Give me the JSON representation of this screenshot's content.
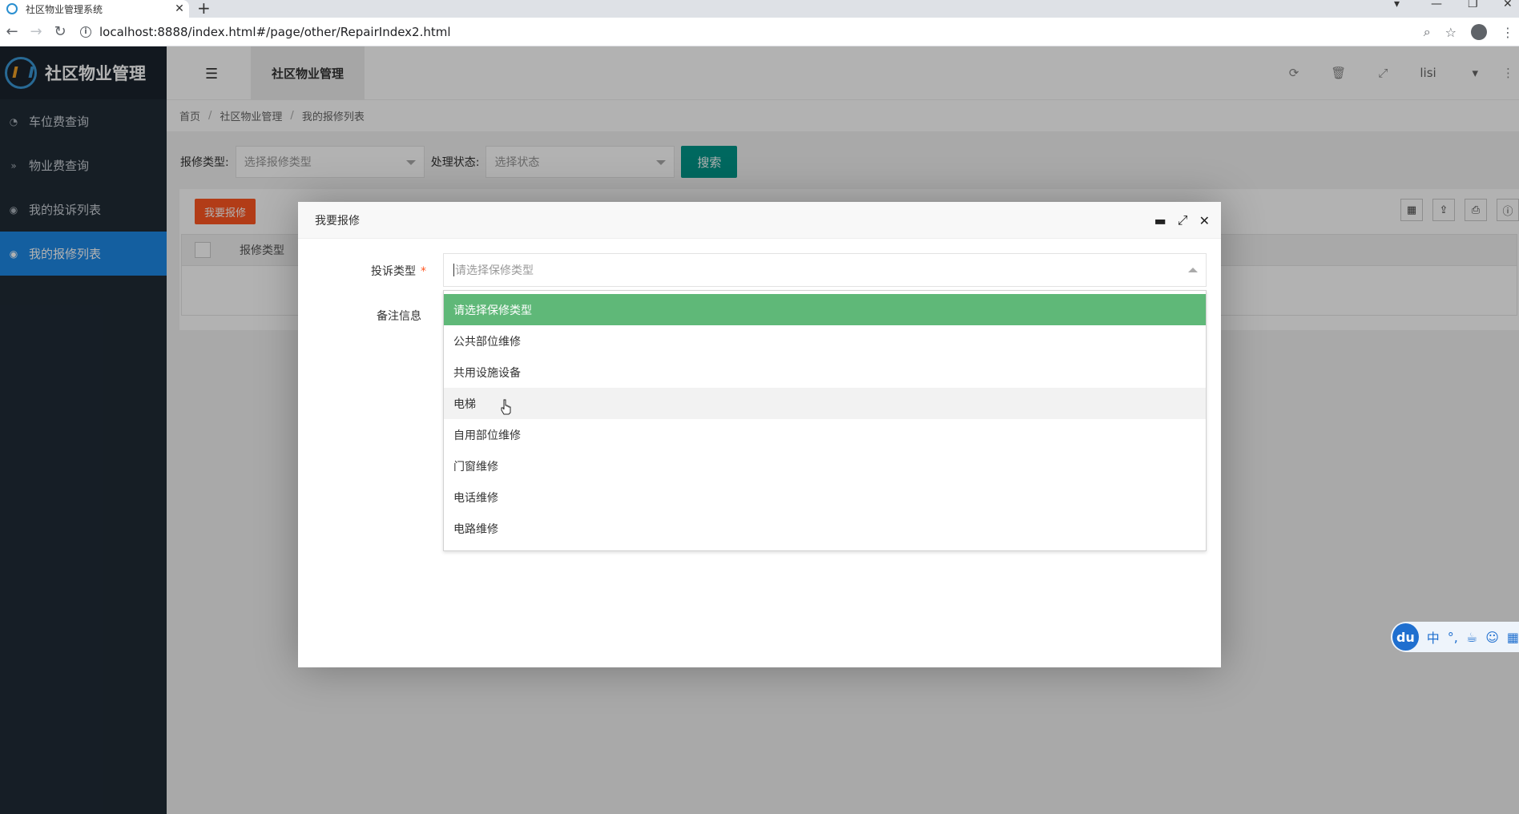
{
  "browser": {
    "tab_title": "社区物业管理系统",
    "tab_close": "✕",
    "new_tab": "+",
    "url": "localhost:8888/index.html#/page/other/RepairIndex2.html"
  },
  "app": {
    "logo_text": "社区物业管理",
    "menu": [
      {
        "label": "车位费查询",
        "icon": "dashboard-icon"
      },
      {
        "label": "物业费查询",
        "icon": "chevron-double-down-icon"
      },
      {
        "label": "我的投诉列表",
        "icon": "circle-dot-icon"
      },
      {
        "label": "我的报修列表",
        "icon": "circle-dot-icon",
        "active": true
      }
    ],
    "header_tab": "社区物业管理",
    "user": "lisi"
  },
  "breadcrumb": [
    "首页",
    "社区物业管理",
    "我的报修列表"
  ],
  "search": {
    "type_label": "报修类型:",
    "type_placeholder": "选择报修类型",
    "status_label": "处理状态:",
    "status_placeholder": "选择状态",
    "button": "搜索"
  },
  "table": {
    "add_button": "我要报修",
    "columns": [
      "报修类型"
    ]
  },
  "dialog": {
    "title": "我要报修",
    "type_label": "投诉类型",
    "required_mark": "*",
    "type_placeholder": "请选择保修类型",
    "remark_label": "备注信息",
    "options": [
      "请选择保修类型",
      "公共部位维修",
      "共用设施设备",
      "电梯",
      "自用部位维修",
      "门窗维修",
      "电话维修",
      "电路维修"
    ],
    "selected_index": 0,
    "hover_index": 3
  },
  "ime": {
    "logo": "du",
    "lang": "中",
    "punct": "°,"
  },
  "colors": {
    "sidebar": "#202b36",
    "active": "#1e88e5",
    "search_button": "#009688",
    "add_button": "#ff5722",
    "selected_option": "#5fb878"
  }
}
